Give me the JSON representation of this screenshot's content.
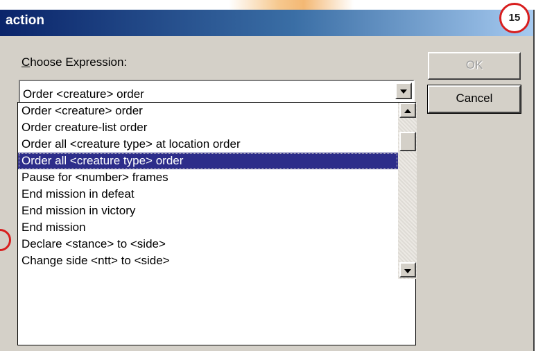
{
  "window": {
    "title": "action"
  },
  "label": {
    "prefix": "",
    "mnemonic": "C",
    "rest": "hoose Expression:"
  },
  "combo": {
    "value": "Order <creature>  order"
  },
  "expressions": [
    "Order <creature>  order",
    "Order creature-list  order",
    "Order all <creature type>  at location  order",
    "Order all <creature type>  order",
    "Pause for <number>  frames",
    "End mission in defeat",
    "End mission in victory",
    "End mission",
    "Declare <stance>  to <side>",
    "Change side <ntt>  to <side>"
  ],
  "selected_index": 3,
  "buttons": {
    "ok": "OK",
    "cancel": "Cancel"
  },
  "annotation": {
    "step": "15"
  },
  "colors": {
    "selection": "#2d2d8a",
    "annotation": "#d81e1e",
    "title_bar": "#0a246a"
  }
}
